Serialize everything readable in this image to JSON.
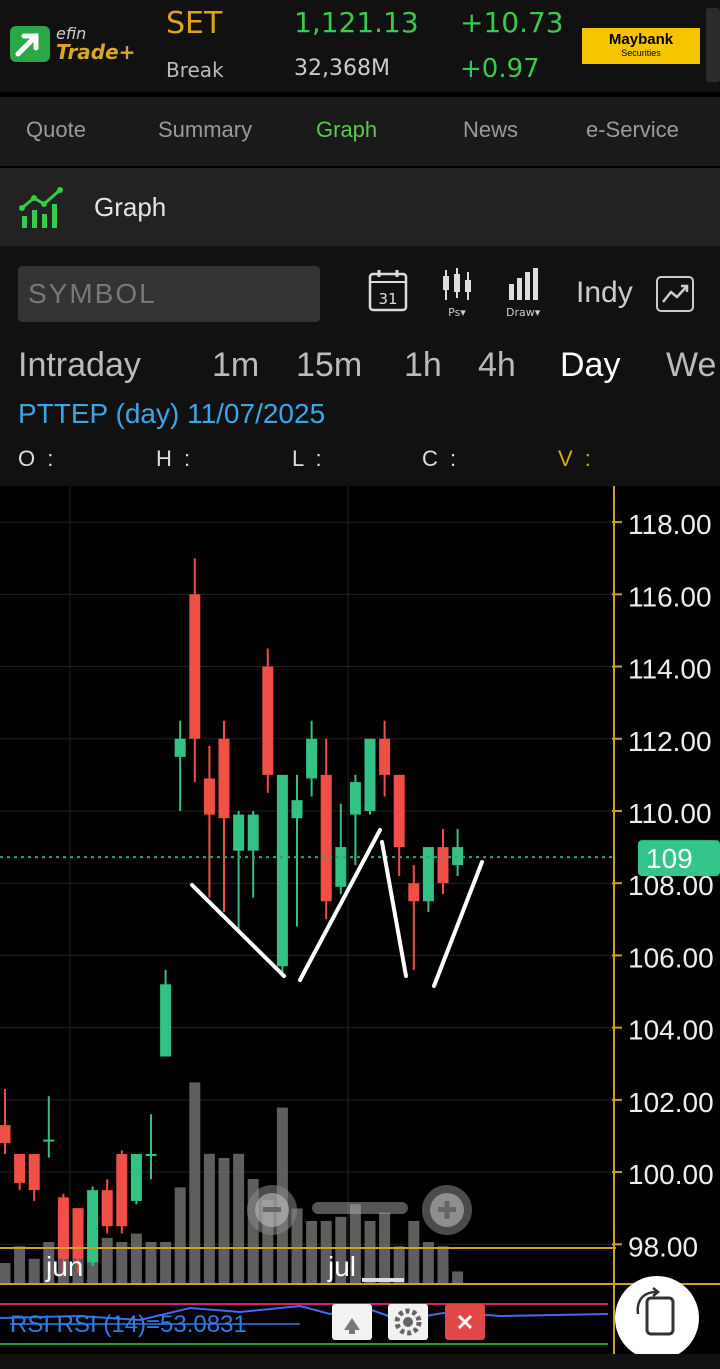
{
  "header": {
    "logo_top": "efin",
    "logo_bottom": "Trade+",
    "index_name": "SET",
    "index_value": "1,121.13",
    "index_change": "+10.73",
    "break_label": "Break",
    "volume": "32,368M",
    "percent_change": "+0.97",
    "broker_name": "Maybank",
    "broker_sub": "Securities"
  },
  "tabs": [
    {
      "label": "Quote"
    },
    {
      "label": "Summary"
    },
    {
      "label": "Graph",
      "active": true
    },
    {
      "label": "News"
    },
    {
      "label": "e-Service"
    }
  ],
  "page_title": "Graph",
  "toolbar": {
    "symbol_placeholder": "SYMBOL",
    "calendar_day": "31",
    "ps_label": "Ps▾",
    "draw_label": "Draw▾",
    "indy_label": "Indy"
  },
  "periods": [
    {
      "label": "Intraday"
    },
    {
      "label": "1m"
    },
    {
      "label": "15m"
    },
    {
      "label": "1h"
    },
    {
      "label": "4h"
    },
    {
      "label": "Day",
      "active": true
    },
    {
      "label": "We"
    }
  ],
  "info": {
    "title": "PTTEP (day) 11/07/2025",
    "o": "O :",
    "h": "H :",
    "l": "L :",
    "c": "C :",
    "v": "V :"
  },
  "colors": {
    "up": "#33c184",
    "down": "#ef4f45",
    "accent": "#5bc74d",
    "axis": "#c9a227"
  },
  "chart_data": {
    "type": "candlestick",
    "yticks": [
      "118.00",
      "116.00",
      "114.00",
      "112.00",
      "110.00",
      "108.00",
      "106.00",
      "104.00",
      "102.00",
      "100.00",
      "98.00"
    ],
    "ylim": [
      96.9,
      119.0
    ],
    "x_labels": [
      "jun",
      "jul"
    ],
    "last_price": "109",
    "candles": [
      {
        "o": 101.3,
        "h": 102.3,
        "l": 100.5,
        "c": 100.8
      },
      {
        "o": 100.5,
        "h": 100.5,
        "l": 99.5,
        "c": 99.7
      },
      {
        "o": 100.5,
        "h": 100.5,
        "l": 99.2,
        "c": 99.5
      },
      {
        "o": 100.9,
        "h": 102.1,
        "l": 100.4,
        "c": 100.9
      },
      {
        "o": 99.3,
        "h": 99.4,
        "l": 97.2,
        "c": 97.6
      },
      {
        "o": 99.0,
        "h": 99.0,
        "l": 97.2,
        "c": 97.6
      },
      {
        "o": 97.5,
        "h": 99.6,
        "l": 97.4,
        "c": 99.5
      },
      {
        "o": 99.5,
        "h": 99.8,
        "l": 98.3,
        "c": 98.5
      },
      {
        "o": 100.5,
        "h": 100.6,
        "l": 98.3,
        "c": 98.5
      },
      {
        "o": 99.2,
        "h": 100.5,
        "l": 99.1,
        "c": 100.5
      },
      {
        "o": 100.5,
        "h": 101.6,
        "l": 99.8,
        "c": 100.5
      },
      {
        "o": 103.2,
        "h": 105.6,
        "l": 103.2,
        "c": 105.2
      },
      {
        "o": 111.5,
        "h": 112.5,
        "l": 110.0,
        "c": 112.0
      },
      {
        "o": 116.0,
        "h": 117.0,
        "l": 110.8,
        "c": 112.0
      },
      {
        "o": 110.9,
        "h": 111.8,
        "l": 107.6,
        "c": 109.9
      },
      {
        "o": 112.0,
        "h": 112.5,
        "l": 107.2,
        "c": 109.8
      },
      {
        "o": 108.9,
        "h": 110.0,
        "l": 106.7,
        "c": 109.9
      },
      {
        "o": 108.9,
        "h": 110.0,
        "l": 107.6,
        "c": 109.9
      },
      {
        "o": 114.0,
        "h": 114.5,
        "l": 110.5,
        "c": 111.0
      },
      {
        "o": 105.7,
        "h": 111.0,
        "l": 105.4,
        "c": 111.0
      },
      {
        "o": 109.8,
        "h": 111.0,
        "l": 106.8,
        "c": 110.3
      },
      {
        "o": 110.9,
        "h": 112.5,
        "l": 110.4,
        "c": 112.0
      },
      {
        "o": 111.0,
        "h": 112.0,
        "l": 107.0,
        "c": 107.5
      },
      {
        "o": 107.9,
        "h": 110.2,
        "l": 107.7,
        "c": 109.0
      },
      {
        "o": 109.9,
        "h": 111.0,
        "l": 108.5,
        "c": 110.8
      },
      {
        "o": 110.0,
        "h": 112.0,
        "l": 109.9,
        "c": 112.0
      },
      {
        "o": 112.0,
        "h": 112.5,
        "l": 110.4,
        "c": 111.0
      },
      {
        "o": 111.0,
        "h": 111.0,
        "l": 108.2,
        "c": 109.0
      },
      {
        "o": 108.0,
        "h": 108.5,
        "l": 105.6,
        "c": 107.5
      },
      {
        "o": 107.5,
        "h": 109.0,
        "l": 107.2,
        "c": 109.0
      },
      {
        "o": 109.0,
        "h": 109.5,
        "l": 107.7,
        "c": 108.0
      },
      {
        "o": 108.5,
        "h": 109.5,
        "l": 108.2,
        "c": 109.0
      }
    ],
    "volume_relative": [
      0.1,
      0.18,
      0.12,
      0.2,
      0.34,
      0.36,
      0.28,
      0.22,
      0.2,
      0.24,
      0.2,
      0.2,
      0.46,
      0.96,
      0.62,
      0.6,
      0.62,
      0.5,
      0.4,
      0.84,
      0.36,
      0.3,
      0.3,
      0.32,
      0.38,
      0.3,
      0.34,
      0.18,
      0.3,
      0.2,
      0.18,
      0.06
    ],
    "annotation": "hand-drawn W pattern lines"
  },
  "rsi": {
    "label": "RSI RSI (14)=53.0831"
  }
}
